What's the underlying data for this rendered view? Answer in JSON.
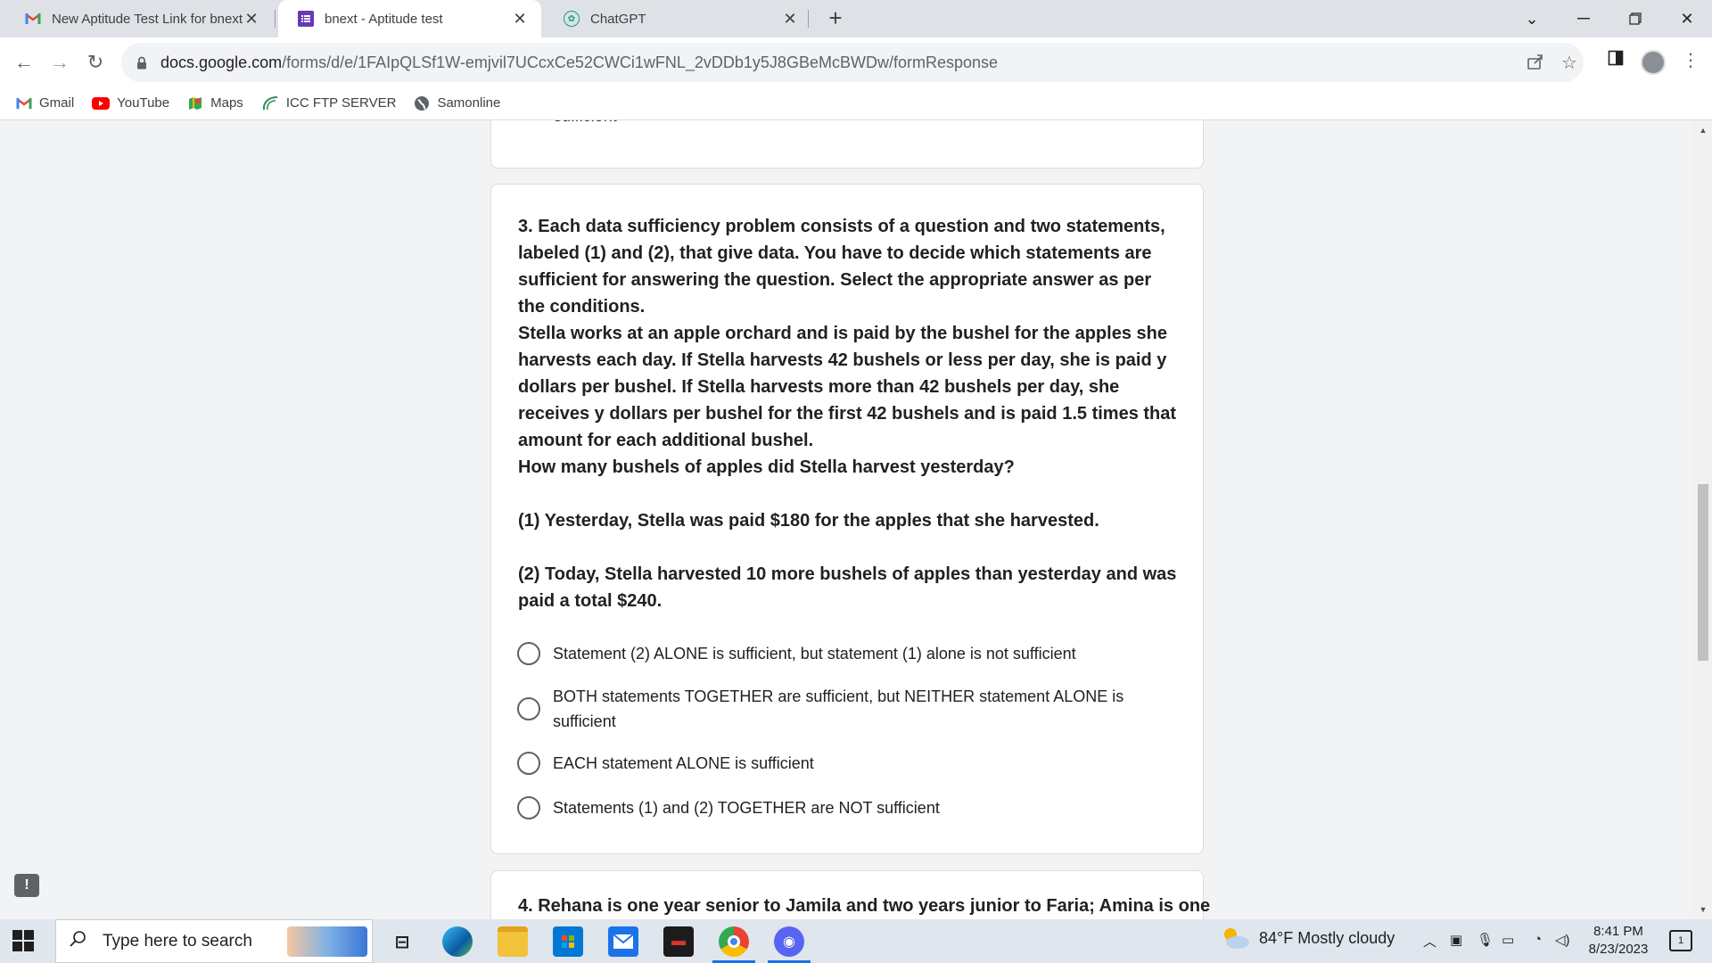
{
  "browser": {
    "tabs": [
      {
        "title": "New Aptitude Test Link for bnext",
        "icon": "gmail-icon"
      },
      {
        "title": "bnext - Aptitude test",
        "icon": "google-forms-icon"
      },
      {
        "title": "ChatGPT",
        "icon": "chatgpt-icon"
      }
    ],
    "new_tab": "+",
    "url_host": "docs.google.com",
    "url_path": "/forms/d/e/1FAIpQLSf1W-emjvil7UCcxCe52CWCi1wFNL_2vDDb1y5J8GBeMcBWDw/formResponse",
    "bookmarks": [
      {
        "label": "Gmail",
        "icon": "gmail-icon"
      },
      {
        "label": "YouTube",
        "icon": "youtube-icon"
      },
      {
        "label": "Maps",
        "icon": "maps-icon"
      },
      {
        "label": "ICC FTP SERVER",
        "icon": "ftp-icon"
      },
      {
        "label": "Samonline",
        "icon": "globe-icon"
      }
    ]
  },
  "form": {
    "previous_tail": "sufficient",
    "question3": {
      "intro": "3. Each data sufficiency problem consists of a question and two statements, labeled (1) and (2), that give data. You have to decide which statements are sufficient for answering the question. Select the appropriate answer as per the conditions.",
      "body": "Stella works at an apple orchard and is paid by the bushel for the apples she harvests each day. If Stella harvests 42 bushels or less per day, she is paid y dollars per bushel. If Stella harvests more than 42 bushels per day, she receives y dollars per bushel for the first 42 bushels and is paid 1.5 times that amount for each additional bushel.",
      "question": "How many bushels of apples did Stella harvest yesterday?",
      "statement1": "(1) Yesterday, Stella was paid $180 for the apples that she harvested.",
      "statement2": "(2) Today, Stella harvested 10 more bushels of apples than yesterday and was paid a total $240.",
      "options": [
        "Statement (2) ALONE is sufficient, but statement (1) alone is not sufficient",
        "BOTH statements TOGETHER are sufficient, but NEITHER statement ALONE is sufficient",
        "EACH statement ALONE is sufficient",
        "Statements (1) and (2) TOGETHER are NOT sufficient"
      ]
    },
    "question4_partial": "4.  Rehana is one year senior to Jamila and two years junior to Faria; Amina is one",
    "report_icon": "!"
  },
  "taskbar": {
    "search_placeholder": "Type here to search",
    "weather": "84°F  Mostly cloudy",
    "time": "8:41 PM",
    "date": "8/23/2023",
    "notification_count": "1"
  }
}
